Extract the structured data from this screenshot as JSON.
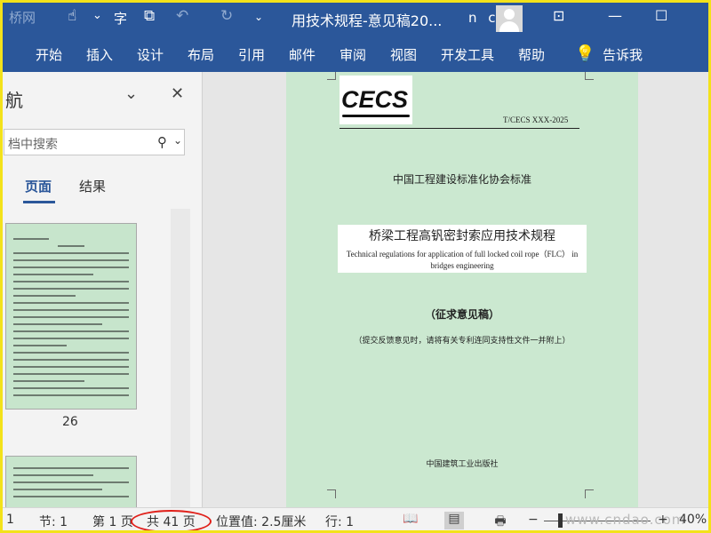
{
  "titlebar": {
    "title": "用技术规程-意见稿20...",
    "user": "n c",
    "watermark_corner": "桥网",
    "qa_icons": [
      "save-icon",
      "touch-mode-icon",
      "chevron-down-icon",
      "spelling-icon",
      "print-preview-icon",
      "undo-icon",
      "redo-icon",
      "customize-icon"
    ],
    "qa_glyphs": {
      "touch": "☝",
      "chev": "⌄",
      "spell": "字",
      "preview": "⧉",
      "undo": "↶",
      "redo": "↻",
      "custom": "⌄"
    },
    "win_glyphs": {
      "ribbon": "⊡",
      "minimize": "—",
      "maximize": "☐"
    }
  },
  "ribbon": {
    "tabs": [
      "开始",
      "插入",
      "设计",
      "布局",
      "引用",
      "邮件",
      "审阅",
      "视图",
      "开发工具",
      "帮助"
    ],
    "tell_me": "告诉我",
    "lightbulb": "💡"
  },
  "nav": {
    "title": "航",
    "chevron": "⌄",
    "close": "✕",
    "search_placeholder": "档中搜索",
    "search_icon": "⚲",
    "search_drop": "⌄",
    "tab_pages": "页面",
    "tab_results": "结果",
    "thumb_page_number": "26"
  },
  "document": {
    "logo": "CECS",
    "standard_number": "T/CECS XXX-2025",
    "association": "中国工程建设标准化协会标准",
    "title_cn": "桥梁工程高钒密封索应用技术规程",
    "title_en_line1": "Technical regulations for application of full locked coil rope（FLC） in",
    "title_en_line2": "bridges engineering",
    "draft": "（征求意见稿）",
    "notice": "（提交反馈意见时，请将有关专利连同支持性文件一并附上）",
    "publisher": "中国建筑工业出版社"
  },
  "statusbar": {
    "page_prefix": "1",
    "section": "节: 1",
    "page": "第 1 页",
    "total": "共 41 页",
    "position": "位置值: 2.5厘米",
    "line": "行: 1",
    "zoom_minus": "−",
    "zoom_plus": "+",
    "zoom": "40%",
    "watermark": "www.cndao.com",
    "view_glyphs": {
      "read": "📖",
      "print": "▤",
      "web": "🖶"
    }
  },
  "colors": {
    "accent": "#2b579a",
    "page_background": "#cbe8d0",
    "highlight_ellipse": "#e0201a",
    "frame": "#f3e21a"
  }
}
